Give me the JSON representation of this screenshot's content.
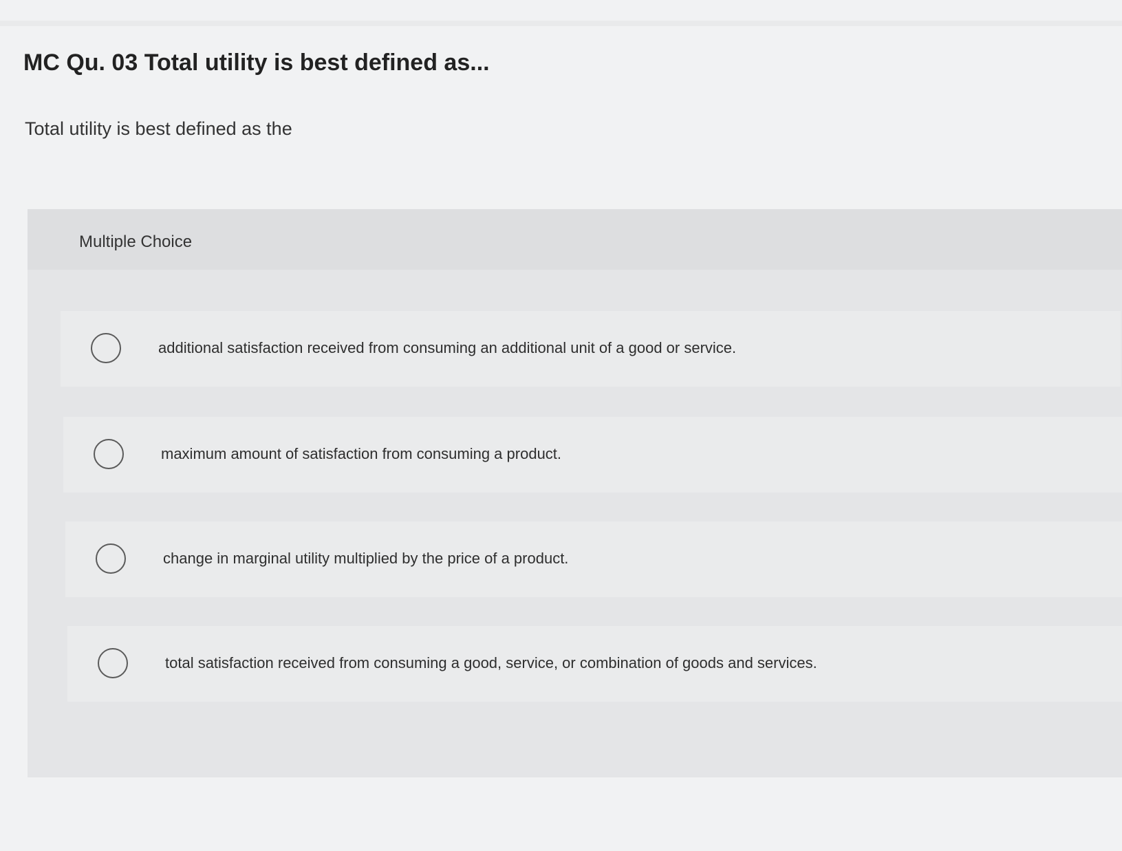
{
  "question": {
    "title": "MC Qu. 03 Total utility is best defined as...",
    "prompt": "Total utility is best defined as the"
  },
  "panel": {
    "label": "Multiple Choice"
  },
  "options": [
    {
      "text": "additional satisfaction received from consuming an additional unit of a good or service.",
      "selected": false
    },
    {
      "text": "maximum amount of satisfaction from consuming a product.",
      "selected": false
    },
    {
      "text": "change in marginal utility multiplied by the price of a product.",
      "selected": false
    },
    {
      "text": "total satisfaction received from consuming a good, service, or combination of goods and services.",
      "selected": false
    }
  ]
}
